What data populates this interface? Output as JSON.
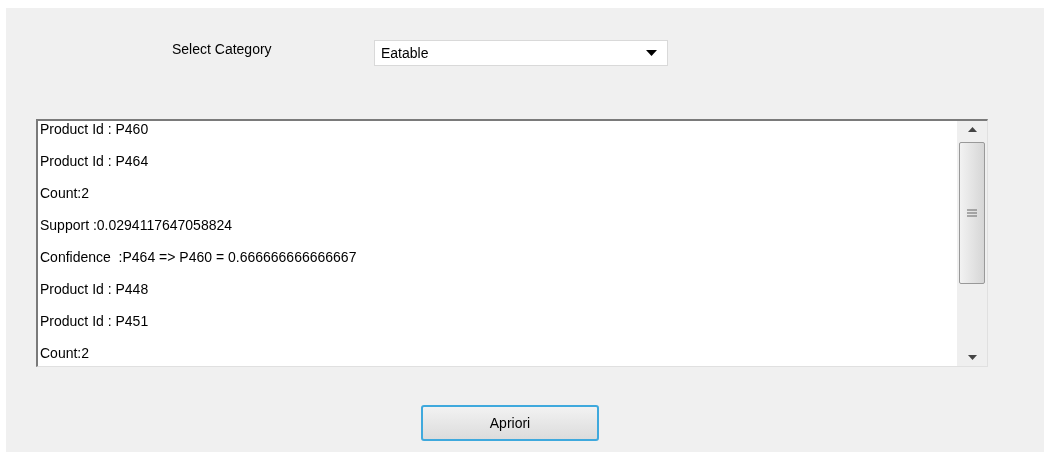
{
  "category": {
    "label": "Select Category",
    "value": "Eatable"
  },
  "results": [
    "Product Id : P460",
    "Product Id : P464",
    "Count:2",
    "Support :0.0294117647058824",
    "Confidence  :P464 => P460 = 0.666666666666667",
    "Product Id : P448",
    "Product Id : P451",
    "Count:2"
  ],
  "button": "Apriori"
}
